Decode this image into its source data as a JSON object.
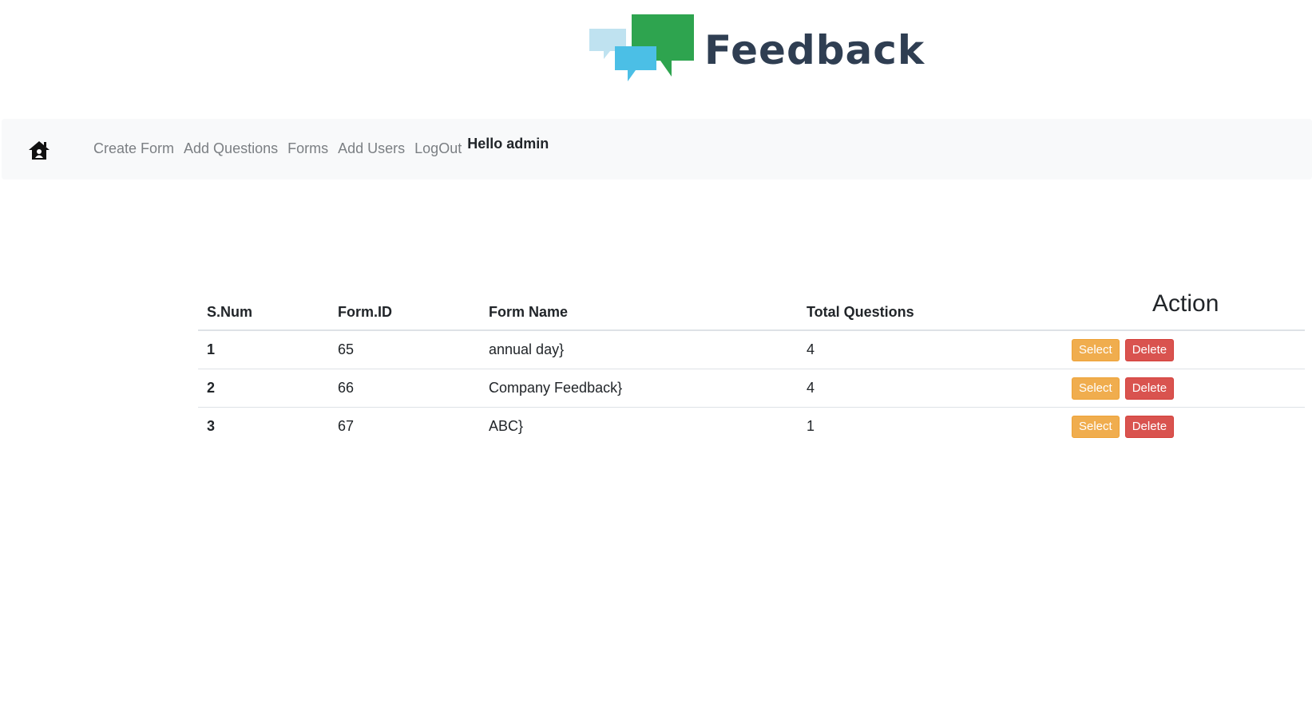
{
  "logo": {
    "text": "Feedback",
    "colors": {
      "green": "#2ea44f",
      "blue": "#4bbfe6",
      "light_blue": "#bfe2f0",
      "text": "#2f3e52"
    }
  },
  "nav": {
    "home_icon": "home-icon",
    "links": [
      "Create Form",
      "Add Questions",
      "Forms",
      "Add Users",
      "LogOut"
    ],
    "greeting": "Hello admin"
  },
  "table": {
    "headers": [
      "S.Num",
      "Form.ID",
      "Form Name",
      "Total Questions",
      "Action"
    ],
    "rows": [
      {
        "snum": "1",
        "form_id": "65",
        "form_name": "annual day}",
        "total_questions": "4",
        "select": "Select",
        "delete": "Delete"
      },
      {
        "snum": "2",
        "form_id": "66",
        "form_name": "Company Feedback}",
        "total_questions": "4",
        "select": "Select",
        "delete": "Delete"
      },
      {
        "snum": "3",
        "form_id": "67",
        "form_name": "ABC}",
        "total_questions": "1",
        "select": "Select",
        "delete": "Delete"
      }
    ]
  },
  "colors": {
    "select_button": "#f0ad4e",
    "delete_button": "#d9534f",
    "navbar_bg": "#f8f9fa"
  }
}
